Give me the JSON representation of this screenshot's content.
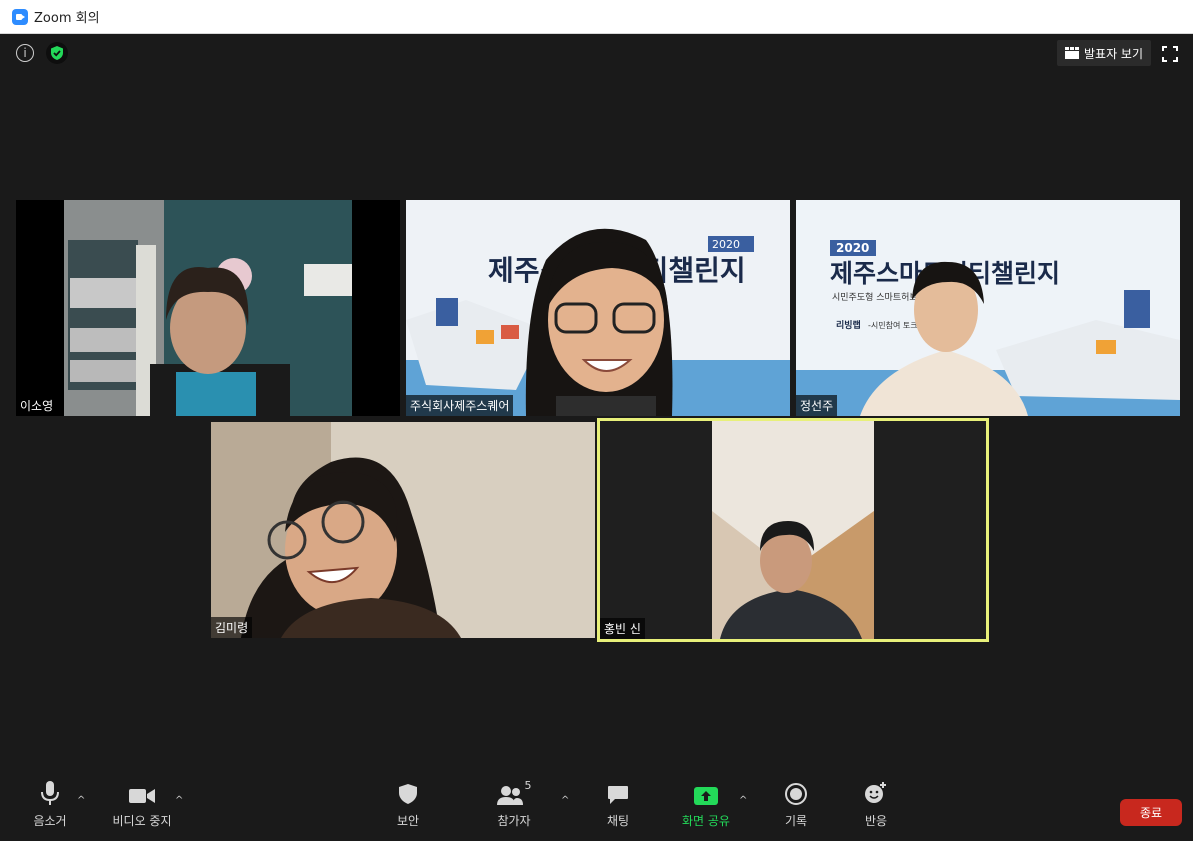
{
  "window": {
    "title": "Zoom 회의"
  },
  "top": {
    "info_icon": "info-icon",
    "security_icon": "shield-check-icon",
    "speaker_view_label": "발표자 보기",
    "fullscreen_icon": "fullscreen-icon"
  },
  "participants": [
    {
      "name": "이소영"
    },
    {
      "name": "주식회사제주스퀘어"
    },
    {
      "name": "정선주"
    },
    {
      "name": "김미령"
    },
    {
      "name": "홍빈 신"
    }
  ],
  "slide": {
    "year": "2020",
    "title": "제주스마트시티챌린지",
    "subtitle": "시민주도형 스마트허브 기반",
    "badge": "리빙랩",
    "tagline": "-시민참여 토크-"
  },
  "toolbar": {
    "mute_label": "음소거",
    "video_label": "비디오 중지",
    "security_label": "보안",
    "participants_label": "참가자",
    "participants_count": "5",
    "chat_label": "채팅",
    "share_label": "화면 공유",
    "record_label": "기록",
    "reactions_label": "반응",
    "end_label": "종료"
  },
  "colors": {
    "active_speaker": "#e8f07a",
    "share_green": "#23d959",
    "end_red": "#c8281e",
    "brand_blue": "#2d8cff"
  }
}
